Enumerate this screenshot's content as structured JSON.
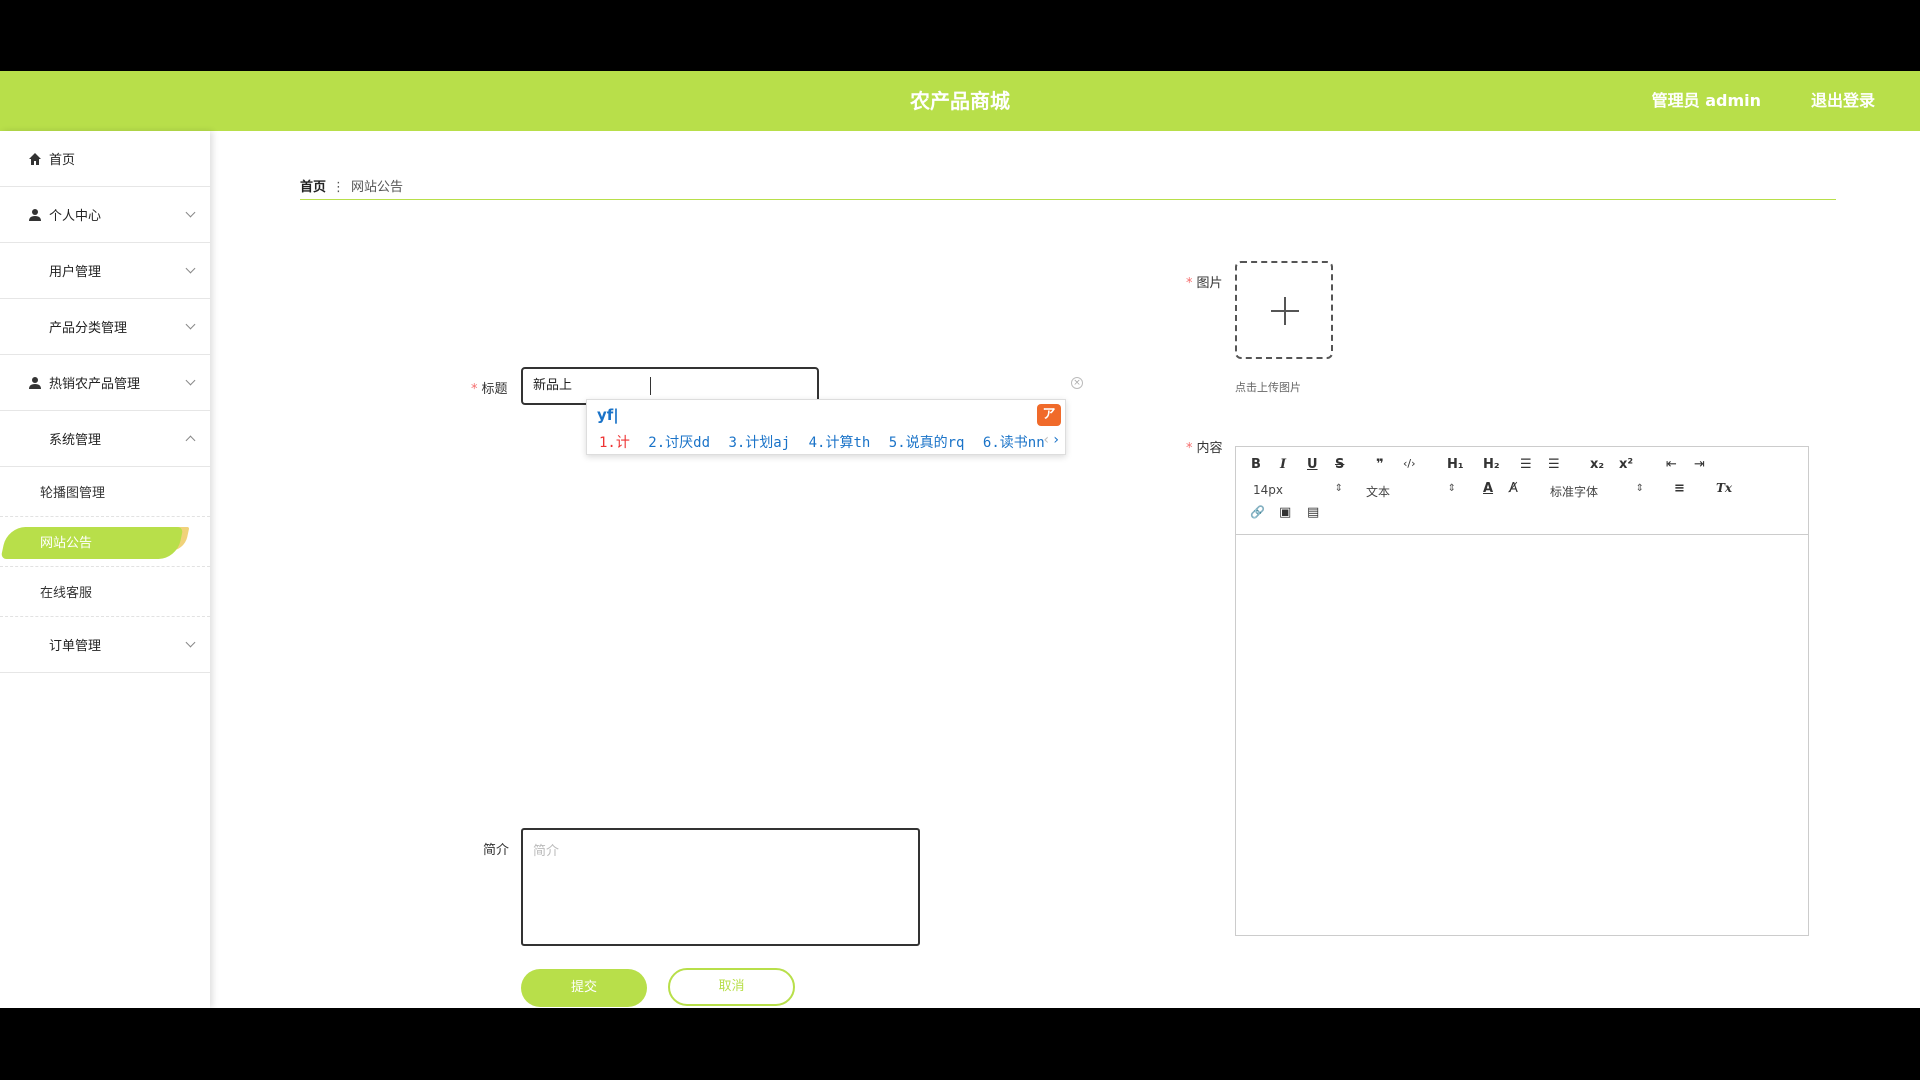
{
  "header": {
    "title": "农产品商城",
    "admin_label": "管理员 admin",
    "logout_label": "退出登录",
    "accent_color": "#b8df4a"
  },
  "sidebar": {
    "items": [
      {
        "label": "首页",
        "icon": "home-icon"
      },
      {
        "label": "个人中心",
        "icon": "user-icon"
      },
      {
        "label": "用户管理",
        "icon": "grid-icon"
      },
      {
        "label": "产品分类管理",
        "icon": "grid-icon"
      },
      {
        "label": "热销农产品管理",
        "icon": "user-icon"
      },
      {
        "label": "系统管理",
        "icon": "grid-icon"
      },
      {
        "label": "订单管理",
        "icon": "grid-icon"
      }
    ],
    "sub_items": [
      {
        "label": "轮播图管理"
      },
      {
        "label": "网站公告",
        "active": true
      },
      {
        "label": "在线客服"
      }
    ]
  },
  "breadcrumb": {
    "home": "首页",
    "separator": "⋮",
    "current": "网站公告"
  },
  "form": {
    "title_label": "标题",
    "title_value": "新品上",
    "image_label": "图片",
    "upload_hint": "点击上传图片",
    "content_label": "内容",
    "intro_label": "简介",
    "intro_placeholder": "简介",
    "submit_label": "提交",
    "cancel_label": "取消",
    "required_mark": "*"
  },
  "ime": {
    "composition": "yf|",
    "logo": "ア",
    "candidates": [
      "1.计",
      "2.讨厌dd",
      "3.计划aj",
      "4.计算th",
      "5.说真的rq",
      "6.读书nn"
    ],
    "nav_prev": "‹",
    "nav_next": "›"
  },
  "editor": {
    "bold": "B",
    "italic": "I",
    "underline": "U",
    "strike": "S",
    "quote": "❞",
    "code": "‹/›",
    "h1": "H₁",
    "h2": "H₂",
    "ordered_list": "☰",
    "bullet_list": "☰",
    "subscript": "x₂",
    "superscript": "x²",
    "indent_out": "⇤",
    "indent_in": "⇥",
    "size_select": "14px",
    "type_select": "文本",
    "font_color": "A",
    "bg_color": "A̸",
    "font_select": "标准字体",
    "align": "≡",
    "clear_format": "Tx",
    "link": "🔗",
    "image": "▣",
    "video": "▤",
    "select_arrow": "⇕"
  }
}
